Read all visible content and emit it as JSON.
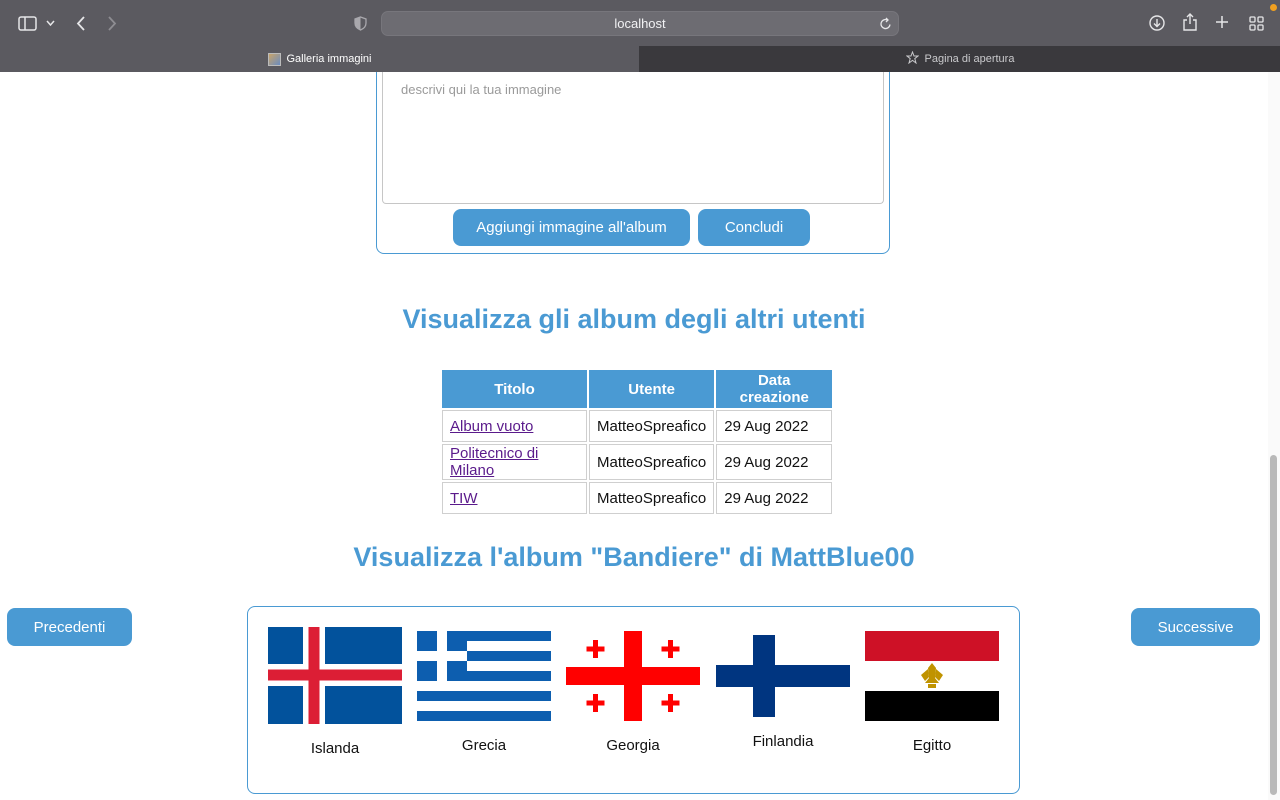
{
  "browser": {
    "url": "localhost",
    "tabs": [
      {
        "label": "Galleria immagini",
        "active": true
      },
      {
        "label": "Pagina di apertura",
        "active": false
      }
    ],
    "icons": [
      "sidebar-icon",
      "chevron-down-icon",
      "back-icon",
      "forward-icon",
      "shield-icon",
      "reload-icon",
      "download-icon",
      "share-icon",
      "new-tab-icon",
      "tab-overview-icon",
      "star-icon"
    ]
  },
  "form": {
    "description_placeholder": "descrivi qui la tua immagine",
    "add_button": "Aggiungi immagine all'album",
    "done_button": "Concludi"
  },
  "other_albums": {
    "heading": "Visualizza gli album degli altri utenti",
    "columns": [
      "Titolo",
      "Utente",
      "Data creazione"
    ],
    "rows": [
      {
        "title": "Album vuoto",
        "user": "MatteoSpreafico",
        "date": "29 Aug 2022"
      },
      {
        "title": "Politecnico di Milano",
        "user": "MatteoSpreafico",
        "date": "29 Aug 2022"
      },
      {
        "title": "TIW",
        "user": "MatteoSpreafico",
        "date": "29 Aug 2022"
      }
    ]
  },
  "album_view": {
    "heading": "Visualizza l'album \"Bandiere\" di MattBlue00",
    "prev_button": "Precedenti",
    "next_button": "Successive",
    "images": [
      {
        "caption": "Islanda",
        "flag": "iceland-flag"
      },
      {
        "caption": "Grecia",
        "flag": "greece-flag"
      },
      {
        "caption": "Georgia",
        "flag": "georgia-flag"
      },
      {
        "caption": "Finlandia",
        "flag": "finland-flag"
      },
      {
        "caption": "Egitto",
        "flag": "egypt-flag"
      }
    ]
  },
  "colors": {
    "accent": "#4a9ad3",
    "link_visited": "#5a1a8b"
  }
}
